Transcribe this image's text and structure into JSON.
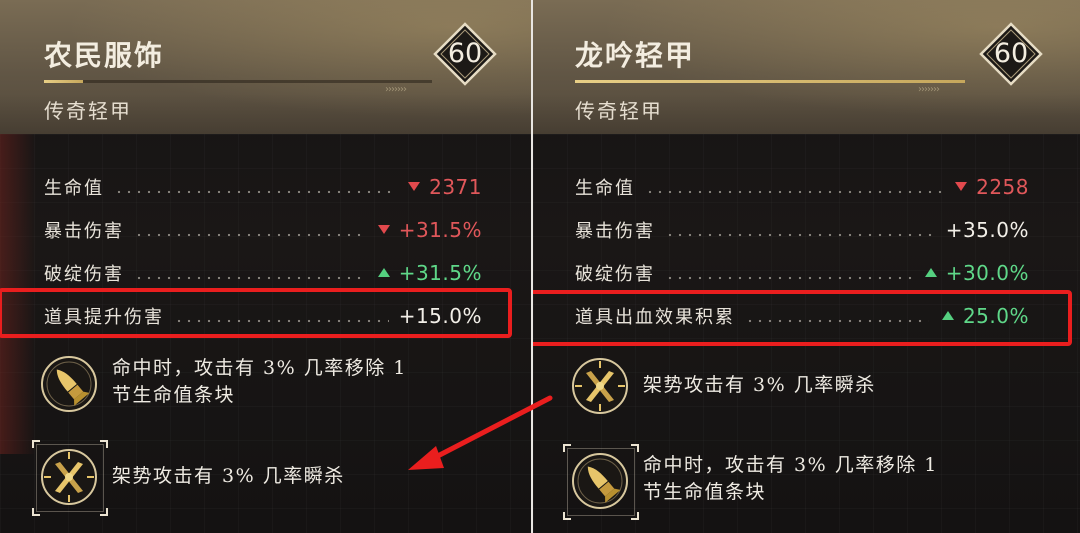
{
  "left_panel": {
    "title": "农民服饰",
    "subtitle": "传奇轻甲",
    "level": "60",
    "progress": 0.1,
    "stats": [
      {
        "name": "生命值",
        "trend": "down",
        "value": "2371"
      },
      {
        "name": "暴击伤害",
        "trend": "down",
        "value": "+31.5%"
      },
      {
        "name": "破绽伤害",
        "trend": "up",
        "value": "+31.5%"
      },
      {
        "name": "道具提升伤害",
        "trend": "none",
        "value": "+15.0%"
      }
    ],
    "skills": [
      {
        "icon": "bullet-emblem-icon",
        "lines": [
          "命中时，攻击有 3% 几率移除 1",
          "节生命值条块"
        ]
      },
      {
        "icon": "crossed-swords-emblem-icon",
        "lines": [
          "架势攻击有 3% 几率瞬杀"
        ]
      }
    ]
  },
  "right_panel": {
    "title": "龙吟轻甲",
    "subtitle": "传奇轻甲",
    "level": "60",
    "progress": 1.0,
    "stats": [
      {
        "name": "生命值",
        "trend": "down",
        "value": "2258"
      },
      {
        "name": "暴击伤害",
        "trend": "none",
        "value": "+35.0%"
      },
      {
        "name": "破绽伤害",
        "trend": "up",
        "value": "+30.0%"
      },
      {
        "name": "道具出血效果积累",
        "trend": "up",
        "value": "25.0%"
      }
    ],
    "skills": [
      {
        "icon": "crossed-swords-emblem-icon",
        "lines": [
          "架势攻击有 3% 几率瞬杀"
        ]
      },
      {
        "icon": "bullet-emblem-icon",
        "lines": [
          "命中时，攻击有 3% 几率移除 1",
          "节生命值条块"
        ]
      }
    ]
  },
  "colors": {
    "stat_down": "#e0575a",
    "stat_up": "#5fd889",
    "highlight": "#ea1e1e",
    "gold": "#d8b65e"
  }
}
